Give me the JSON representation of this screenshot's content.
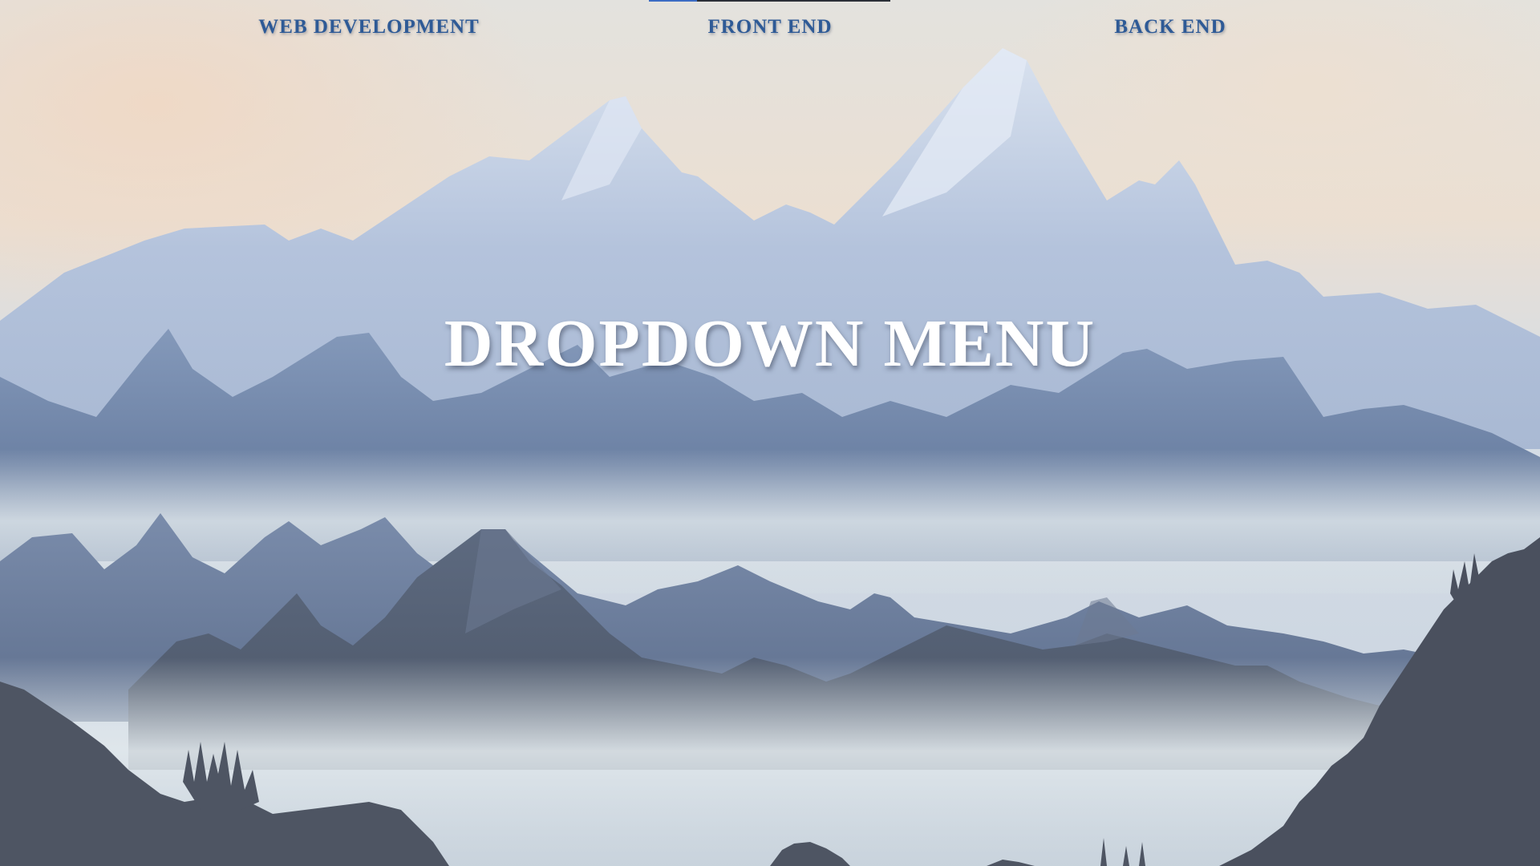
{
  "nav": {
    "items": [
      {
        "label": "WEB DEVELOPMENT"
      },
      {
        "label": "FRONT END"
      },
      {
        "label": "BACK END"
      }
    ],
    "active_index": 1
  },
  "hero": {
    "title": "DROPDOWN MENU"
  },
  "colors": {
    "nav_text": "#2e5a96",
    "title_text": "#ffffff",
    "accent": "#3b6cc4"
  }
}
